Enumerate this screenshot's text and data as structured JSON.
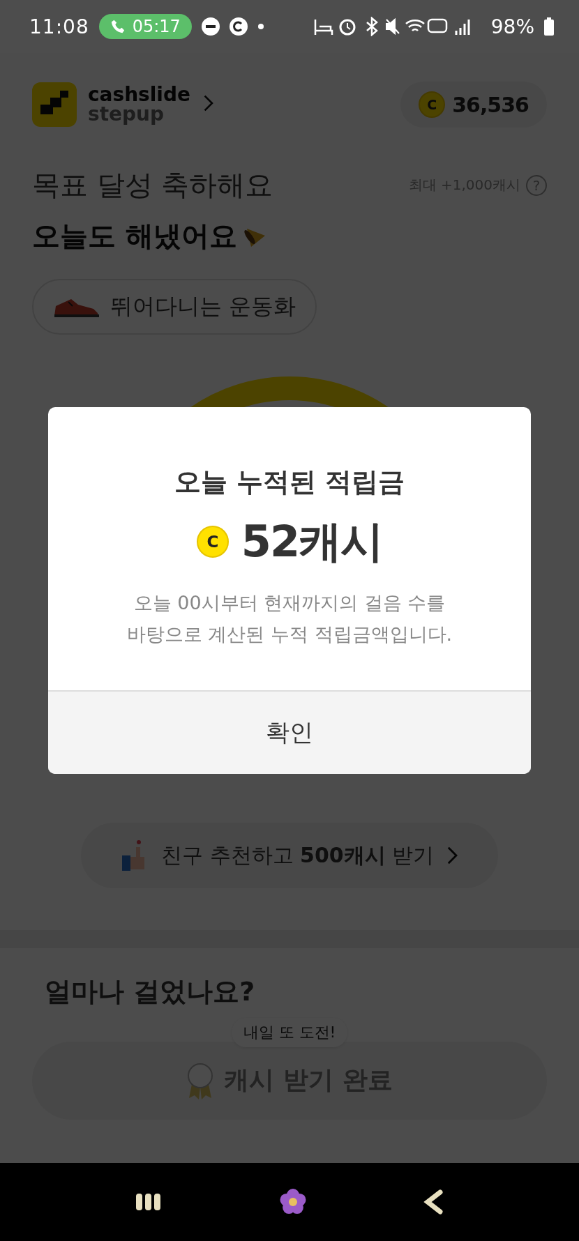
{
  "status_bar": {
    "time": "11:08",
    "call_timer": "05:17",
    "battery": "98%"
  },
  "header": {
    "brand_top": "cashslide",
    "brand_bottom": "stepup",
    "coin_symbol": "C",
    "balance": "36,536"
  },
  "headline": {
    "subtitle": "목표 달성 축하해요",
    "max_reward": "최대 +1,000캐시",
    "help_symbol": "?",
    "title": "오늘도 해냈어요"
  },
  "item_chip": {
    "label": "뛰어다니는 운동화"
  },
  "referral": {
    "text": "친구 추천하고 **500캐시** 받기"
  },
  "section_title": "얼마나 걸었나요?",
  "tooltip": "내일 또 도전!",
  "reward_button": {
    "label": "캐시 받기 완료",
    "disabled": true
  },
  "dialog": {
    "title": "오늘 누적된 적립금",
    "coin_symbol": "C",
    "amount": "52캐시",
    "description": "오늘 00시부터 현재까지의 걸음 수를\n바탕으로 계산된 누적 적립금액입니다.",
    "confirm": "확인"
  }
}
